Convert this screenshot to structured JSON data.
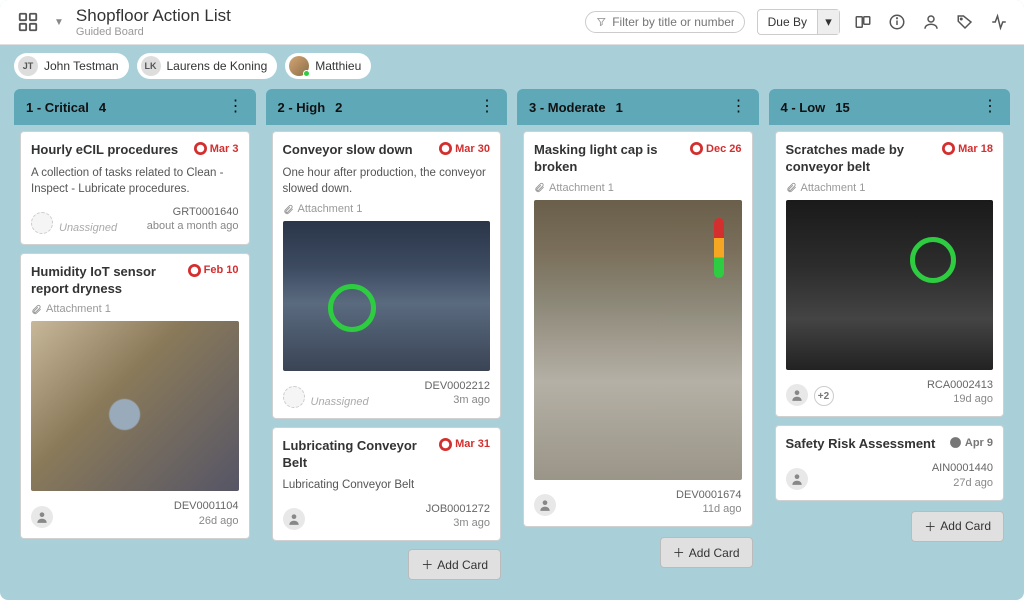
{
  "header": {
    "title": "Shopfloor Action List",
    "subtitle": "Guided Board",
    "filter_placeholder": "Filter by title or number",
    "due_label": "Due By"
  },
  "users": [
    {
      "initials": "JT",
      "name": "John Testman"
    },
    {
      "initials": "LK",
      "name": "Laurens de Koning"
    },
    {
      "name": "Matthieu",
      "photo": true
    }
  ],
  "columns": [
    {
      "title": "1 - Critical",
      "count": "4",
      "cards": [
        {
          "title": "Hourly eCIL procedures",
          "due": "Mar 3",
          "due_red": true,
          "desc": "A collection of tasks related to Clean - Inspect - Lubricate procedures.",
          "assignee": "unassigned",
          "id": "GRT0001640",
          "age": "about a month ago"
        },
        {
          "title": "Humidity IoT sensor report dryness",
          "due": "Feb 10",
          "due_red": true,
          "attachment": "Attachment  1",
          "image": "sensor",
          "assignee": "person",
          "id": "DEV0001104",
          "age": "26d ago"
        }
      ]
    },
    {
      "title": "2 - High",
      "count": "2",
      "cards": [
        {
          "title": "Conveyor slow down",
          "due": "Mar 30",
          "due_red": true,
          "desc": "One hour after production, the conveyor slowed down.",
          "attachment": "Attachment  1",
          "image": "conveyor",
          "assignee": "unassigned",
          "id": "DEV0002212",
          "age": "3m ago"
        },
        {
          "title": "Lubricating Conveyor Belt",
          "due": "Mar 31",
          "due_red": true,
          "desc": "Lubricating Conveyor Belt",
          "assignee": "person",
          "id": "JOB0001272",
          "age": "3m ago"
        }
      ]
    },
    {
      "title": "3 - Moderate",
      "count": "1",
      "cards": [
        {
          "title": "Masking light cap is broken",
          "due": "Dec 26",
          "due_red": true,
          "attachment": "Attachment  1",
          "image": "factory",
          "image_tall": true,
          "assignee": "person",
          "id": "DEV0001674",
          "age": "11d ago"
        }
      ]
    },
    {
      "title": "4 - Low",
      "count": "15",
      "cards": [
        {
          "title": "Scratches made by conveyor belt",
          "due": "Mar 18",
          "due_red": true,
          "attachment": "Attachment  1",
          "image": "belt",
          "assignee": "person",
          "more": "+2",
          "id": "RCA0002413",
          "age": "19d ago"
        },
        {
          "title": "Safety Risk Assessment",
          "due": "Apr 9",
          "due_red": false,
          "assignee": "person",
          "id": "AIN0001440",
          "age": "27d ago"
        }
      ]
    }
  ],
  "add_card_label": "Add Card",
  "unassigned_label": "Unassigned"
}
